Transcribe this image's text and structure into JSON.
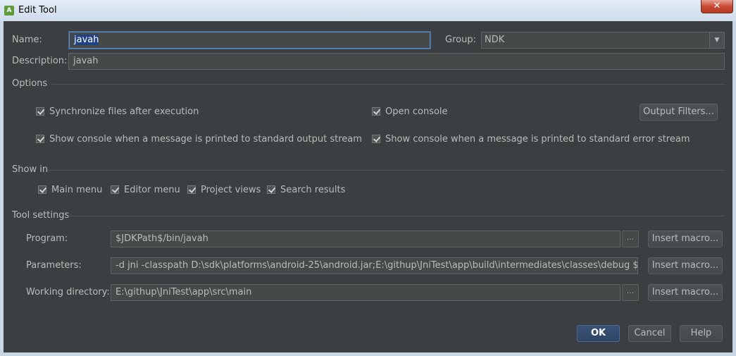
{
  "window": {
    "title": "Edit Tool",
    "close_glyph": "✕"
  },
  "form": {
    "name_label": "Name:",
    "name_value": "javah",
    "group_label": "Group:",
    "group_value": "NDK",
    "description_label": "Description:",
    "description_value": "javah"
  },
  "options": {
    "heading": "Options",
    "sync_files": "Synchronize files after execution",
    "open_console": "Open console",
    "output_filters": "Output Filters...",
    "show_console_stdout": "Show console when a message is printed to standard output stream",
    "show_console_stderr": "Show console when a message is printed to standard error stream"
  },
  "show_in": {
    "heading": "Show in",
    "main_menu": "Main menu",
    "editor_menu": "Editor menu",
    "project_views": "Project views",
    "search_results": "Search results"
  },
  "tool_settings": {
    "heading": "Tool settings",
    "program_label": "Program:",
    "program_value": "$JDKPath$/bin/javah",
    "parameters_label": "Parameters:",
    "parameters_value": "-d jni -classpath D:\\sdk\\platforms\\android-25\\android.jar;E:\\githup\\JniTest\\app\\build\\intermediates\\classes\\debug $FileClass$",
    "working_dir_label": "Working directory:",
    "working_dir_value": "E:\\githup\\JniTest\\app\\src\\main",
    "browse_glyph": "...",
    "insert_macro": "Insert macro..."
  },
  "footer": {
    "ok": "OK",
    "cancel": "Cancel",
    "help": "Help"
  },
  "colors": {
    "background": "#3c3f41",
    "selection": "#214283",
    "accent": "#5a90c8"
  }
}
